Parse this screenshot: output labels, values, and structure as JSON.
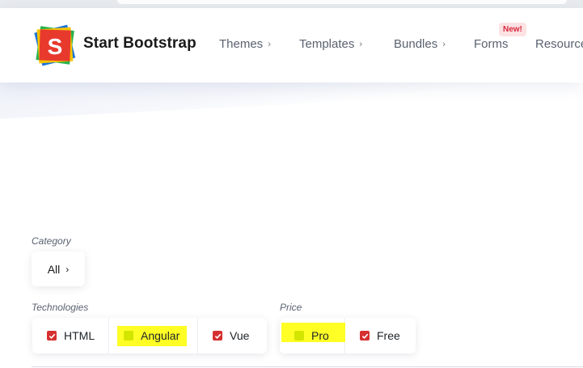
{
  "brand": {
    "name": "Start Bootstrap",
    "logo_letter": "S"
  },
  "nav": {
    "items": [
      {
        "label": "Themes",
        "chevron": "›"
      },
      {
        "label": "Templates",
        "chevron": "›"
      },
      {
        "label": "Bundles",
        "chevron": "›"
      },
      {
        "label": "Forms",
        "chevron": ""
      },
      {
        "label": "Resources",
        "chevron": ""
      }
    ],
    "forms_badge": "New!"
  },
  "filters": {
    "category_label": "Category",
    "category_button": "All",
    "category_chevron": "›",
    "technologies_label": "Technologies",
    "technologies": [
      {
        "label": "HTML",
        "checked": true,
        "highlighted": false
      },
      {
        "label": "Angular",
        "checked": false,
        "highlighted": true
      },
      {
        "label": "Vue",
        "checked": true,
        "highlighted": false
      }
    ],
    "price_label": "Price",
    "price": [
      {
        "label": "Pro",
        "checked": false,
        "highlighted": true
      },
      {
        "label": "Free",
        "checked": true,
        "highlighted": false
      }
    ]
  },
  "colors": {
    "checkbox_checked": "#d63030",
    "highlight": "#ffff26",
    "badge_bg": "#fde2e4",
    "badge_text": "#d6293e"
  },
  "icons": [
    "start-bootstrap-logo-icon",
    "chevron-right-icon",
    "checkmark-icon"
  ]
}
